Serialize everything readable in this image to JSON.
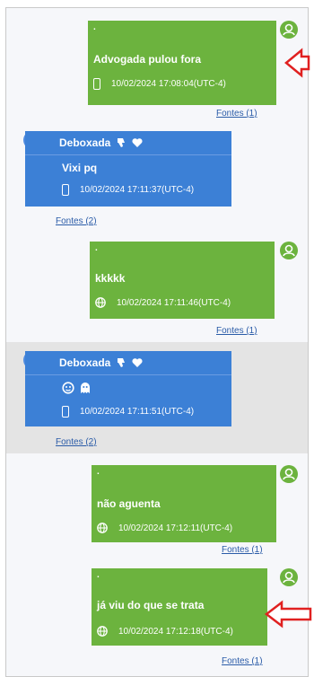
{
  "messages": [
    {
      "sender_label": ".",
      "text": "Advogada pulou fora",
      "timestamp": "10/02/2024 17:08:04(UTC-4)",
      "source_icon": "phone-icon",
      "sources": "Fontes (1)"
    },
    {
      "sender_label": "Deboxada",
      "text": "Vixi pq",
      "timestamp": "10/02/2024 17:11:37(UTC-4)",
      "source_icon": "phone-icon",
      "sources": "Fontes (2)"
    },
    {
      "sender_label": ".",
      "text": "kkkkk",
      "timestamp": "10/02/2024 17:11:46(UTC-4)",
      "source_icon": "globe-icon",
      "sources": "Fontes (1)"
    },
    {
      "sender_label": "Deboxada",
      "text": "emoji-text",
      "timestamp": "10/02/2024 17:11:51(UTC-4)",
      "source_icon": "phone-icon",
      "sources": "Fontes (2)"
    },
    {
      "sender_label": ".",
      "text": "não aguenta",
      "timestamp": "10/02/2024 17:12:11(UTC-4)",
      "source_icon": "globe-icon",
      "sources": "Fontes (1)"
    },
    {
      "sender_label": ".",
      "text": "já viu do que se trata",
      "timestamp": "10/02/2024 17:12:18(UTC-4)",
      "source_icon": "globe-icon",
      "sources": "Fontes (1)"
    }
  ],
  "colors": {
    "green_bubble": "#6cb33e",
    "blue_bubble": "#3c80d6",
    "link": "#2b5ca8",
    "highlight_row": "#e4e4e4",
    "annotation_arrow": "#e02020"
  }
}
